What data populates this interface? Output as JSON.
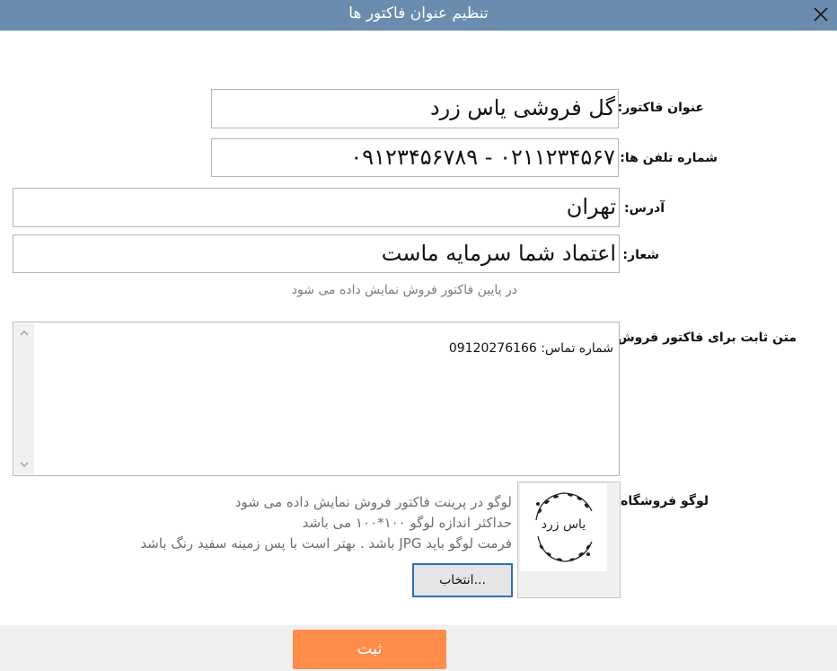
{
  "window": {
    "title": "تنظیم عنوان فاکتور ها",
    "close_icon": "close-icon",
    "accent": "#6a8daf"
  },
  "form": {
    "invoice_title": {
      "label": "عنوان فاکتور:",
      "value": "گل فروشی یاس زرد"
    },
    "phones": {
      "label": "شماره تلفن ها:",
      "value": "۰۲۱۱۲۳۴۵۶۷ - ۰۹۱۲۳۴۵۶۷۸۹"
    },
    "address": {
      "label": "آدرس:",
      "value": "تهران"
    },
    "slogan": {
      "label": "شعار:",
      "value": "اعتماد شما سرمایه ماست"
    },
    "slogan_hint": "در پایین فاکتور فروش نمایش داده می شود",
    "fixed_text": {
      "label": "متن ثابت برای فاکتور فروش:",
      "value": "شماره تماس: 09120276166"
    },
    "logo": {
      "label": "لوگو فروشگاه:",
      "note_lines": [
        "لوگو در پرینت فاکتور فروش نمایش داده می شود",
        "حداکثر اندازه لوگو ۱۰۰*۱۰۰ می باشد",
        "فرمت لوگو باید JPG باشد . بهتر است با پس زمینه سفید رنگ باشد"
      ],
      "image_text": "یاس زرد",
      "select_label": "انتخاب..."
    }
  },
  "footer": {
    "submit_label": "ثبت",
    "submit_color": "#ff8c48"
  }
}
